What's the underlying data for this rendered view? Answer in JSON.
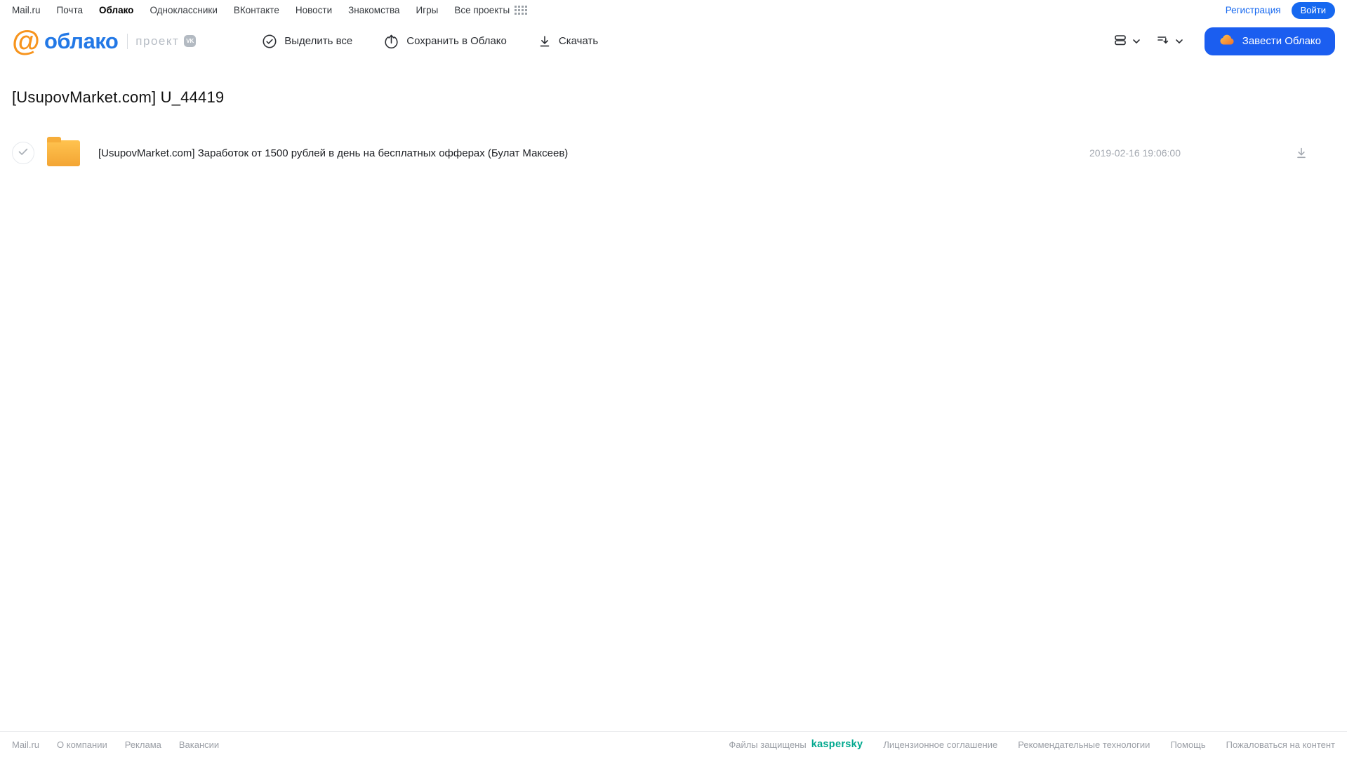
{
  "topnav": {
    "links": [
      {
        "label": "Mail.ru"
      },
      {
        "label": "Почта"
      },
      {
        "label": "Облако",
        "active": true
      },
      {
        "label": "Одноклассники"
      },
      {
        "label": "ВКонтакте"
      },
      {
        "label": "Новости"
      },
      {
        "label": "Знакомства"
      },
      {
        "label": "Игры"
      },
      {
        "label": "Все проекты"
      }
    ],
    "registration_label": "Регистрация",
    "login_label": "Войти"
  },
  "header": {
    "logo": {
      "at_glyph": "@",
      "text": "облако",
      "project_label": "проект",
      "vk_badge": "VK"
    },
    "toolbar": {
      "select_all": "Выделить все",
      "save_to_cloud": "Сохранить в Облако",
      "download": "Скачать"
    },
    "get_cloud_button_label": "Завести Облако"
  },
  "main": {
    "title": "[UsupovMarket.com] U_44419",
    "files": [
      {
        "type": "folder",
        "name": "[UsupovMarket.com] Заработок от 1500 рублей в день на бесплатных офферах (Булат Максеев)",
        "date": "2019-02-16 19:06:00"
      }
    ]
  },
  "footer": {
    "left_links": [
      "Mail.ru",
      "О компании",
      "Реклама",
      "Вакансии"
    ],
    "protected_by": "Файлы защищены",
    "kaspersky": "kaspersky",
    "right_links": [
      "Лицензионное соглашение",
      "Рекомендательные технологии",
      "Помощь",
      "Пожаловаться на контент"
    ]
  },
  "colors": {
    "accent_blue": "#1668f0",
    "logo_blue": "#2278E6",
    "logo_orange": "#F7941D",
    "folder_orange": "#F9B03C",
    "kaspersky_green": "#00A88E"
  }
}
